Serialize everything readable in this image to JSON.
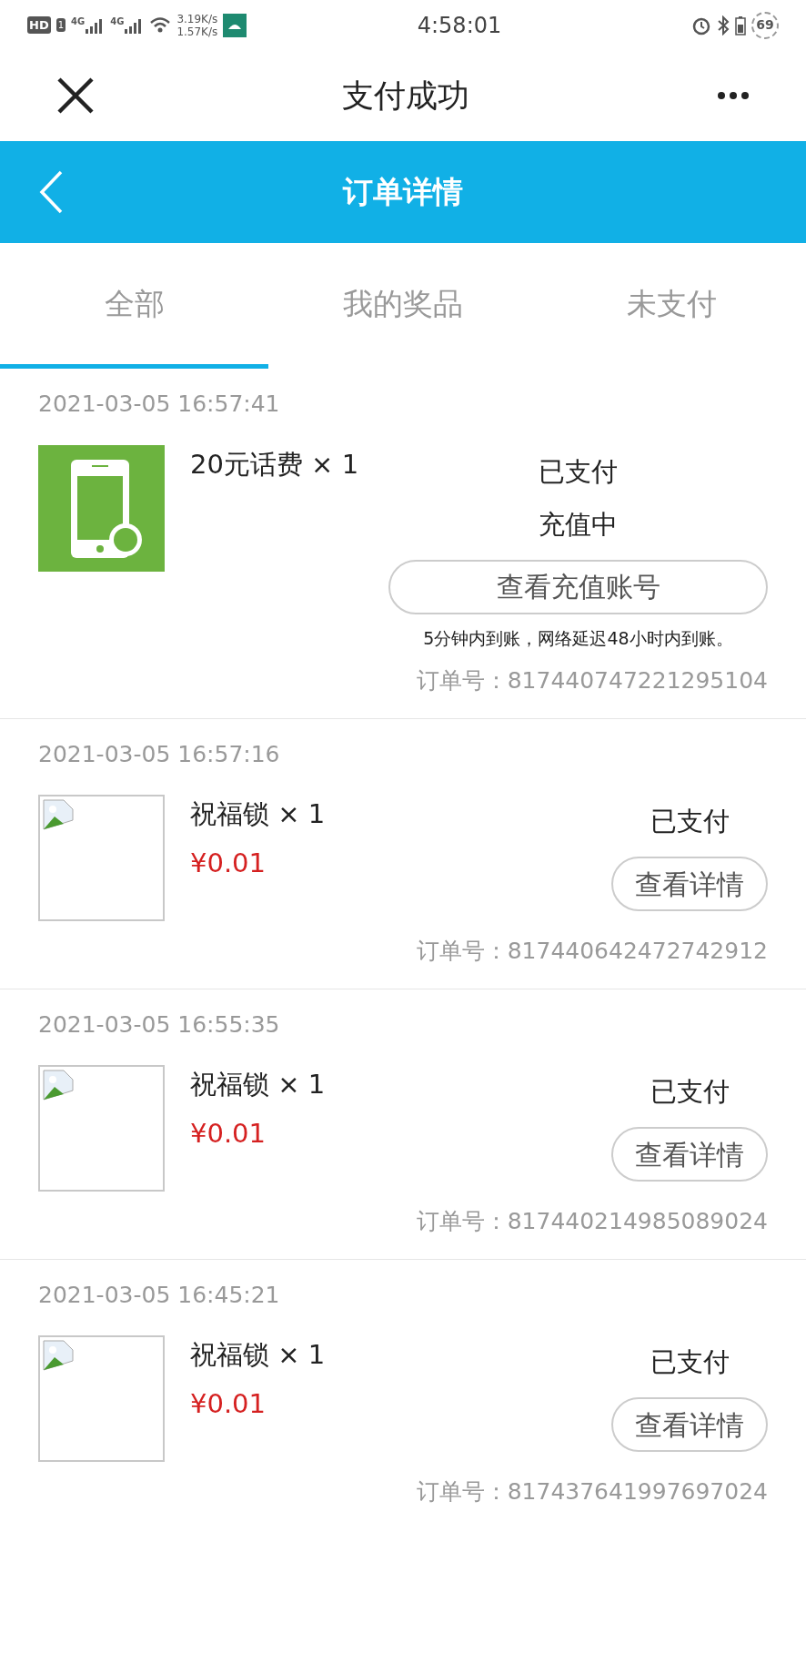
{
  "status_bar": {
    "hd": "HD",
    "sim": "1",
    "networks": [
      "4G",
      "4G"
    ],
    "speed_up": "3.19K/s",
    "speed_down": "1.57K/s",
    "time": "4:58:01",
    "battery": "69"
  },
  "nav_bar": {
    "title": "支付成功"
  },
  "header": {
    "title": "订单详情"
  },
  "tabs": [
    {
      "label": "全部",
      "selected": true
    },
    {
      "label": "我的奖品",
      "selected": false
    },
    {
      "label": "未支付",
      "selected": false
    }
  ],
  "orders": [
    {
      "date": "2021-03-05 16:57:41",
      "image": {
        "kind": "picture"
      },
      "name": "20元话费 × 1",
      "statuses": [
        "已支付",
        "充值中"
      ],
      "button": "查看充值账号",
      "note": "5分钟内到账，网络延迟48小时内到账。",
      "order_no": "订单号：817440747221295104"
    },
    {
      "date": "2021-03-05 16:57:16",
      "image": {
        "kind": "broken"
      },
      "name": "祝福锁 × 1",
      "price": "¥0.01",
      "statuses": [
        "已支付"
      ],
      "button": "查看详情",
      "order_no": "订单号：817440642472742912"
    },
    {
      "date": "2021-03-05 16:55:35",
      "image": {
        "kind": "broken"
      },
      "name": "祝福锁 × 1",
      "price": "¥0.01",
      "statuses": [
        "已支付"
      ],
      "button": "查看详情",
      "order_no": "订单号：817440214985089024"
    },
    {
      "date": "2021-03-05 16:45:21",
      "image": {
        "kind": "broken"
      },
      "name": "祝福锁 × 1",
      "price": "¥0.01",
      "statuses": [
        "已支付"
      ],
      "button": "查看详情",
      "order_no": "订单号：817437641997697024"
    }
  ]
}
